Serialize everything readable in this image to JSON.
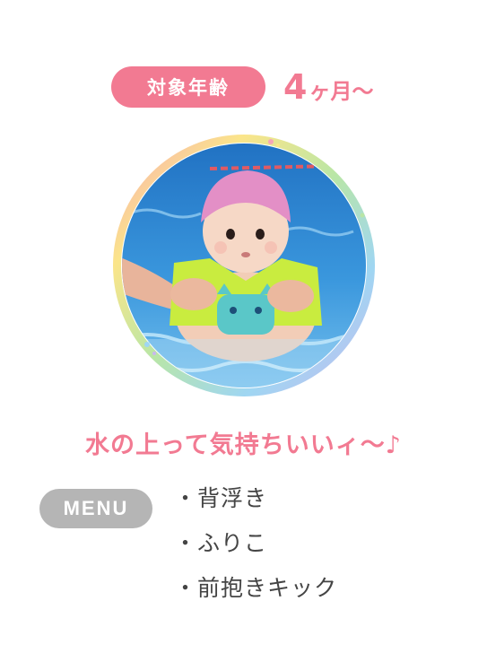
{
  "age": {
    "label": "対象年齢",
    "value_number": "4",
    "value_unit": "ヶ月〜"
  },
  "photo": {
    "subject": "baby-in-pool"
  },
  "catchphrase": "水の上って気持ちいいィ〜♪",
  "menu": {
    "label": "MENU",
    "items": [
      "背浮き",
      "ふりこ",
      "前抱きキック"
    ]
  },
  "colors": {
    "accent_pink": "#f27a92",
    "menu_badge_gray": "#b5b5b5",
    "menu_text": "#444444",
    "pool_blue": "#2f8fd6",
    "cap_pink": "#e38fc6"
  }
}
